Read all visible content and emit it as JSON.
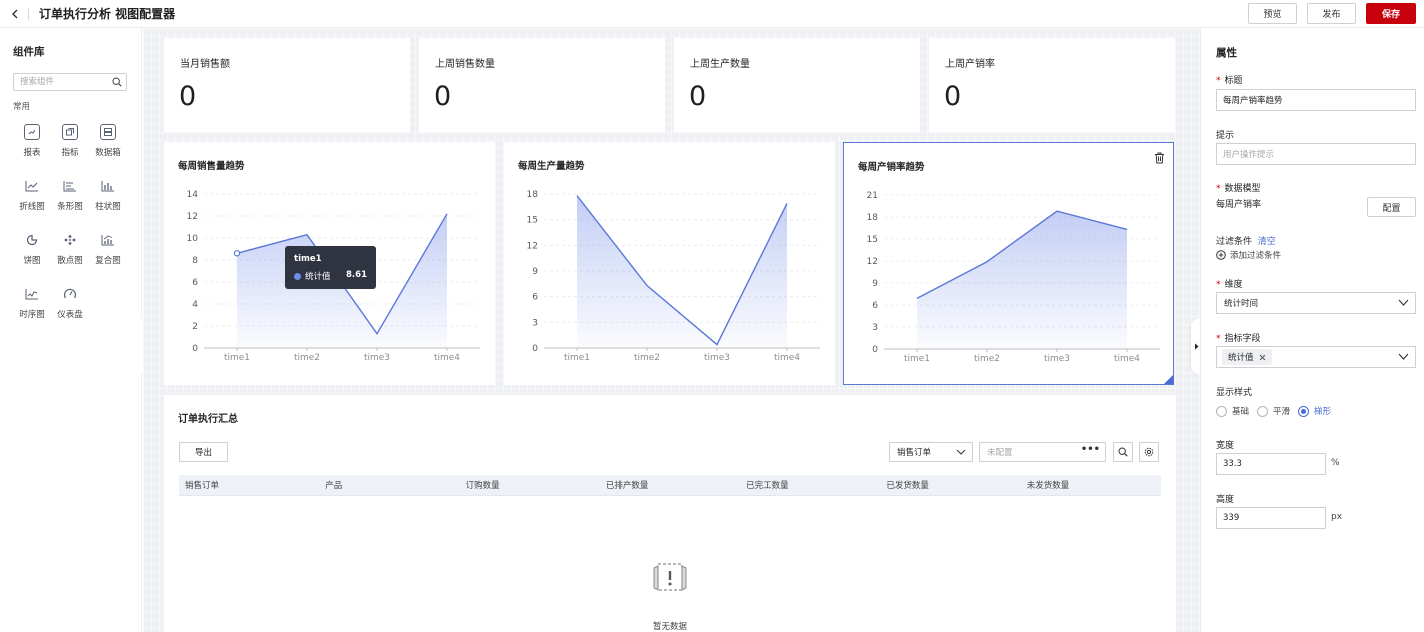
{
  "header": {
    "title": "订单执行分析 视图配置器",
    "preview_label": "预览",
    "publish_label": "发布",
    "save_label": "保存"
  },
  "sidebar": {
    "title": "组件库",
    "search_placeholder": "搜索组件",
    "section": "常用",
    "items": [
      {
        "label": "报表",
        "icon": "report-icon"
      },
      {
        "label": "指标",
        "icon": "indicator-icon"
      },
      {
        "label": "数据箱",
        "icon": "databox-icon"
      },
      {
        "label": "折线图",
        "icon": "line-chart-icon"
      },
      {
        "label": "条形图",
        "icon": "hbar-chart-icon"
      },
      {
        "label": "柱状图",
        "icon": "bar-chart-icon"
      },
      {
        "label": "饼图",
        "icon": "pie-chart-icon"
      },
      {
        "label": "散点图",
        "icon": "scatter-chart-icon"
      },
      {
        "label": "复合图",
        "icon": "combo-chart-icon"
      },
      {
        "label": "时序图",
        "icon": "timeseries-chart-icon"
      },
      {
        "label": "仪表盘",
        "icon": "gauge-icon"
      }
    ]
  },
  "kpis": [
    {
      "label": "当月销售额",
      "value": "0"
    },
    {
      "label": "上周销售数量",
      "value": "0"
    },
    {
      "label": "上周生产数量",
      "value": "0"
    },
    {
      "label": "上周产销率",
      "value": "0"
    }
  ],
  "tooltip": {
    "title": "time1",
    "label": "统计值",
    "value": "8.61"
  },
  "chart_data": [
    {
      "type": "area",
      "title": "每周销售量趋势",
      "categories": [
        "time1",
        "time2",
        "time3",
        "time4"
      ],
      "values": [
        8.61,
        10.3,
        1.3,
        12.2
      ],
      "ylim": [
        0,
        14
      ],
      "yticks": [
        0,
        2,
        4,
        6,
        8,
        10,
        12,
        14
      ],
      "grid": true,
      "selected": false
    },
    {
      "type": "area",
      "title": "每周生产量趋势",
      "categories": [
        "time1",
        "time2",
        "time3",
        "time4"
      ],
      "values": [
        17.8,
        7.3,
        0.4,
        16.9
      ],
      "ylim": [
        0,
        18
      ],
      "yticks": [
        0,
        3,
        6,
        9,
        12,
        15,
        18
      ],
      "grid": true,
      "selected": false
    },
    {
      "type": "area",
      "title": "每周产销率趋势",
      "categories": [
        "time1",
        "time2",
        "time3",
        "time4"
      ],
      "values": [
        6.9,
        11.9,
        18.8,
        16.3
      ],
      "ylim": [
        0,
        21
      ],
      "yticks": [
        0,
        3,
        6,
        9,
        12,
        15,
        18,
        21
      ],
      "grid": true,
      "selected": true
    }
  ],
  "table": {
    "title": "订单执行汇总",
    "export_label": "导出",
    "order_select": "销售订单",
    "config_placeholder": "未配置",
    "columns": [
      "销售订单",
      "产品",
      "订购数量",
      "已排产数量",
      "已完工数量",
      "已发货数量",
      "未发货数量"
    ],
    "empty_text": "暂无数据"
  },
  "panel": {
    "title": "属性",
    "title_label": "标题",
    "title_value": "每周产销率趋势",
    "hint_label": "提示",
    "hint_placeholder": "用户操作提示",
    "model_label": "数据模型",
    "model_value": "每周产销率",
    "config_label": "配置",
    "filter_label": "过滤条件",
    "clear_label": "清空",
    "add_filter_label": "添加过滤条件",
    "dimension_label": "维度",
    "dimension_value": "统计时间",
    "metric_label": "指标字段",
    "metric_tag": "统计值",
    "style_label": "显示样式",
    "style_options": [
      "基础",
      "平滑",
      "梯形"
    ],
    "style_selected": "梯形",
    "width_label": "宽度",
    "width_value": "33.3",
    "width_unit": "%",
    "height_label": "高度",
    "height_value": "339",
    "height_unit": "px"
  },
  "colors": {
    "accent": "#4a6ad6",
    "line": "#5b78d8",
    "save": "#c7000b"
  }
}
